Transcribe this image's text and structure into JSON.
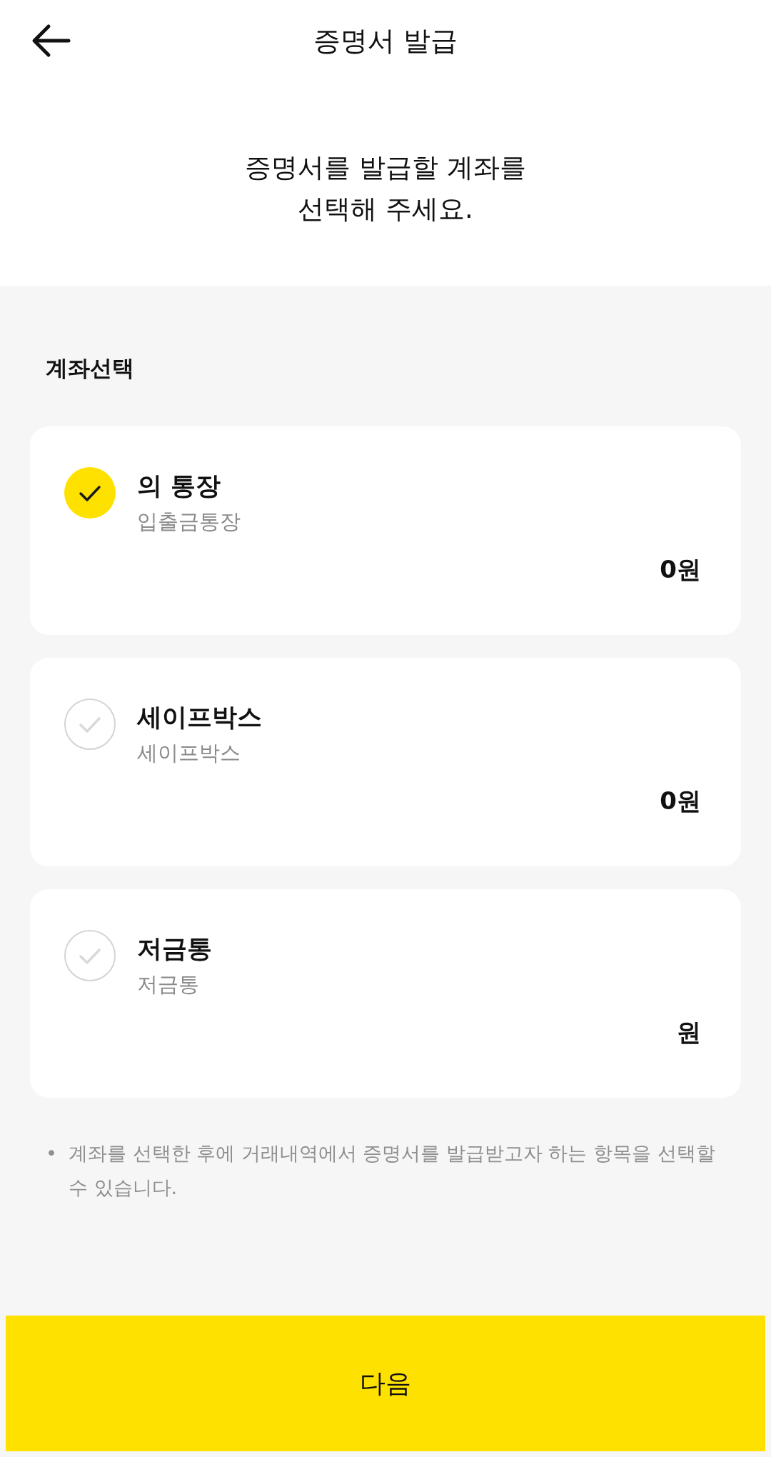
{
  "header": {
    "title": "증명서 발급"
  },
  "prompt": "증명서를 발급할 계좌를\n선택해 주세요.",
  "section_title": "계좌선택",
  "accounts": [
    {
      "name": "의 통장",
      "type": "입출금통장",
      "balance": "0원",
      "selected": true
    },
    {
      "name": "세이프박스",
      "type": "세이프박스",
      "balance": "0원",
      "selected": false
    },
    {
      "name": "저금통",
      "type": "저금통",
      "balance": "원",
      "selected": false
    }
  ],
  "note_bullet": "•",
  "note": "계좌를 선택한 후에 거래내역에서 증명서를 발급받고자 하는 항목을 선택할 수 있습니다.",
  "next_button": "다음"
}
